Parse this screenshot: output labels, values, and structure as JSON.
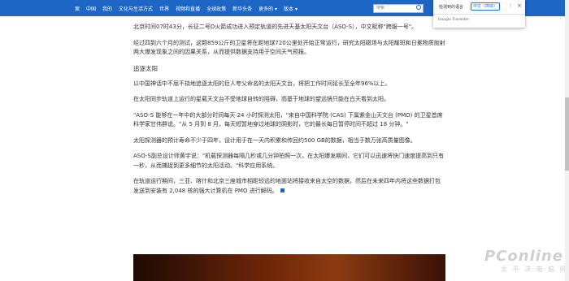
{
  "nav": {
    "items": [
      "案",
      "中国",
      "我的",
      "文化与生活方式",
      "世界",
      "视频和直播",
      "全球政策",
      "新华头条",
      "更多的 ▾",
      "版本 ▾"
    ]
  },
  "search": {
    "placeholder": "搜索"
  },
  "translate": {
    "detect_label": "检测到的语言",
    "target_button": "中文（简体）",
    "more": "⋮",
    "close": "×",
    "footer": "Google Translate"
  },
  "article": {
    "p1": "北京时间07时43分，长征二号D火箭成功进入预定轨道的先进天基太阳天文台（ASO-S），中文昵称\"跨服一号\"。",
    "p2": "经过四到六个月的测试，这颗859公斤的卫星将在距地球720公里处开始正常运行，研究太阳磁场与太阳耀斑和日冕物质抛射两大爆发现象之间的因果关系，从而提供数据支持用于空间天气预报。",
    "heading": "追逐太阳",
    "p3": "以中国神话中不屈不挠地追逐太阳的巨人夸父命名的太阳天文台，将把工作时间延长至全年96%以上。",
    "p4": "在太阳同步轨道上运行的星载天文台不受地球自转的阻碍，而基于地球的望远镜只能在白天看到太阳。",
    "p5": "\"ASO-S 能够在一年中的大部分时间每天 24 小时探测太阳，\"来自中国科学院 (CAS) 下属紫金山天文台 (PMO) 的卫星首席科学家甘伟群说。\"从 5 月到 8 月，每天短暂地穿过地球的阴影时，它的最长每日暂停时间不超过 18 分钟。\"",
    "p6": "太阳探测器的预计寿命不少于四年，设计用于在一天内积累和传回约500 GB的数据，相当于数万张高质量图像。",
    "p7": "ASO-S副总设计师黄宇说：\"机载探测器每隔几秒或几分钟拍照一次，在太阳爆发期间，它们可以迅速将快门速度提高到只有一秒，从而捕捉到更多细节的太阳活动。\"科学应用系统。",
    "p8": "在轨道运行期间，三亚、喀什和北京三座城市相距较远的地面站将接收来自太空的数据，然后在未来四年内将这些数据打包发送到安装有 2,048 核的强大计算机在 PMO 进行解码。"
  },
  "watermark": {
    "brand": "PConline",
    "sub": "太 平 洋 电 脑 网"
  },
  "colors": {
    "nav_bg": "#1e66c6",
    "text": "#333333",
    "accent": "#1a73e8"
  }
}
